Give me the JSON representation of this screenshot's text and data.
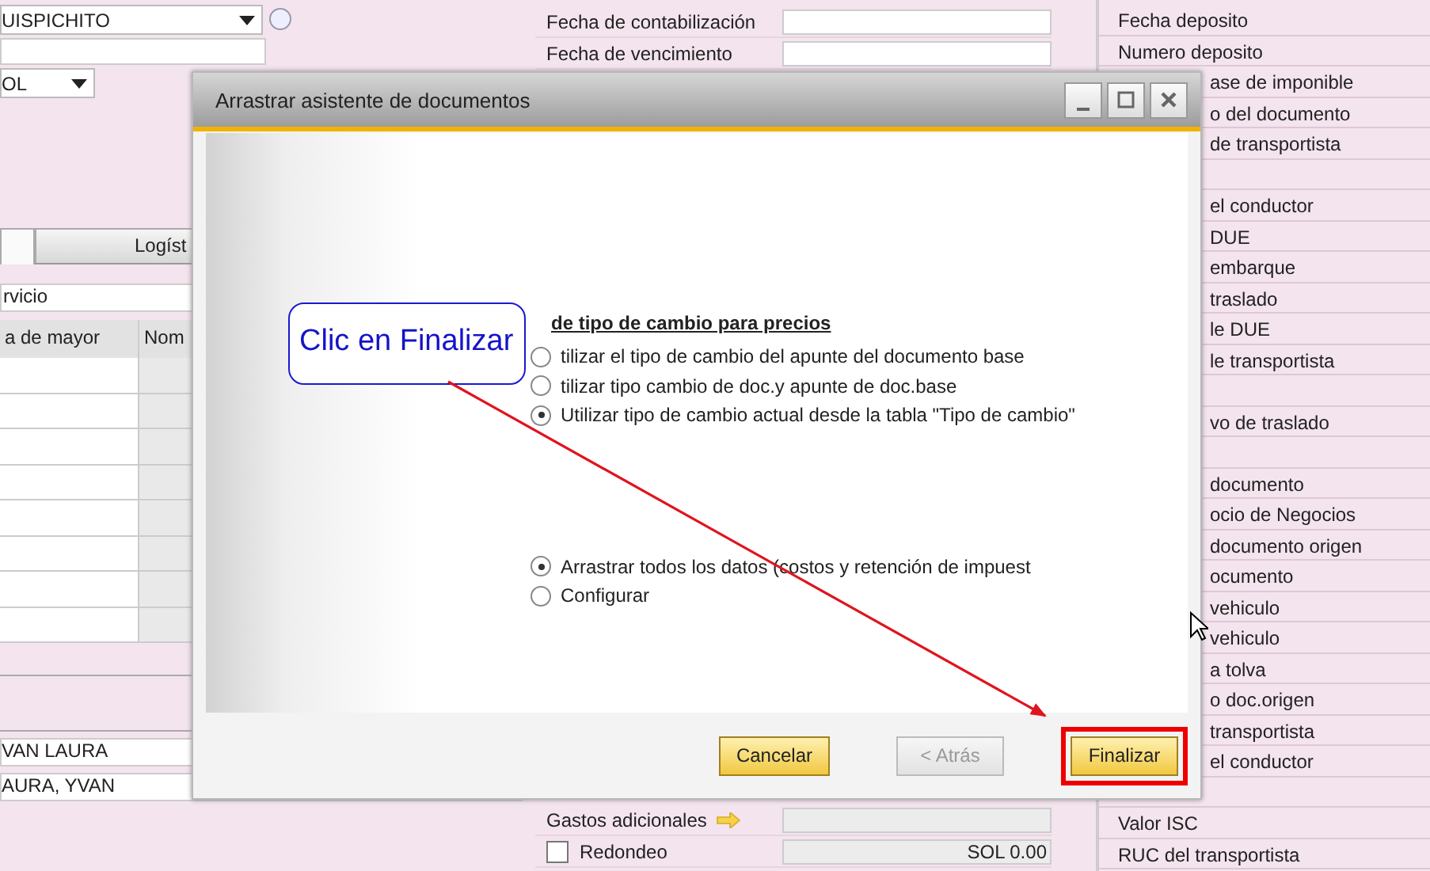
{
  "left_form": {
    "partner_dropdown": "UISPICHITO",
    "currency_dropdown": "OL",
    "tabs": [
      {
        "selected": true
      },
      {
        "label": "Logíst",
        "selected": false
      }
    ],
    "service_field": "rvicio",
    "table": {
      "columns": [
        "a de mayor",
        "Nom"
      ]
    },
    "contact_fields": [
      "VAN LAURA",
      "AURA, YVAN"
    ]
  },
  "date_fields": [
    {
      "label": "Fecha de contabilización"
    },
    {
      "label": "Fecha de vencimiento"
    }
  ],
  "totals": [
    {
      "kind": "link",
      "label": "Gastos adicionales"
    },
    {
      "kind": "check",
      "label": "Redondeo",
      "checked": false,
      "value": "SOL 0.00"
    }
  ],
  "user_fields": [
    {
      "kind": "full",
      "label": "Fecha deposito"
    },
    {
      "kind": "full",
      "label": "Numero deposito"
    },
    {
      "kind": "covered",
      "label": "ase de imponible"
    },
    {
      "kind": "covered",
      "label": "o del documento"
    },
    {
      "kind": "covered",
      "label": "de transportista"
    },
    {
      "kind": "covered"
    },
    {
      "kind": "covered",
      "label": "el conductor"
    },
    {
      "kind": "covered",
      "label": "DUE"
    },
    {
      "kind": "covered",
      "label": "embarque"
    },
    {
      "kind": "covered",
      "label": "traslado"
    },
    {
      "kind": "covered",
      "label": "le DUE"
    },
    {
      "kind": "covered",
      "label": "le transportista"
    },
    {
      "kind": "covered"
    },
    {
      "kind": "covered",
      "label": "vo de traslado"
    },
    {
      "kind": "covered"
    },
    {
      "kind": "covered",
      "label": "documento"
    },
    {
      "kind": "covered",
      "label": "ocio de Negocios"
    },
    {
      "kind": "covered",
      "label": "documento origen"
    },
    {
      "kind": "covered",
      "label": "ocumento"
    },
    {
      "kind": "covered",
      "label": "vehiculo"
    },
    {
      "kind": "covered",
      "label": "vehiculo"
    },
    {
      "kind": "covered",
      "label": "a tolva"
    },
    {
      "kind": "covered",
      "label": "o doc.origen"
    },
    {
      "kind": "covered",
      "label": "transportista"
    },
    {
      "kind": "covered",
      "label": "el conductor"
    },
    {
      "kind": "covered"
    },
    {
      "kind": "full",
      "label": "Valor ISC"
    },
    {
      "kind": "full",
      "label": "RUC del transportista"
    }
  ],
  "dialog": {
    "title": "Arrastrar asistente de documentos",
    "heading": "de tipo de cambio para precios",
    "rate_options": [
      {
        "label": "tilizar el tipo de cambio del apunte del documento base",
        "selected": false
      },
      {
        "label": "tilizar tipo cambio de doc.y apunte de doc.base",
        "selected": false
      },
      {
        "label": "Utilizar tipo de cambio actual desde la tabla \"Tipo de cambio\"",
        "selected": true
      }
    ],
    "copy_options": [
      {
        "label": "Arrastrar todos los datos (costos y retención de impuest",
        "selected": true
      },
      {
        "label": "Configurar",
        "selected": false
      }
    ],
    "buttons": [
      {
        "label": "Cancelar",
        "disabled": false,
        "highlighted": false
      },
      {
        "label": "< Atrás",
        "disabled": true,
        "highlighted": false
      },
      {
        "label": "Finalizar",
        "disabled": false,
        "highlighted": true
      }
    ]
  },
  "callout": {
    "text": "Clic en Finalizar"
  }
}
